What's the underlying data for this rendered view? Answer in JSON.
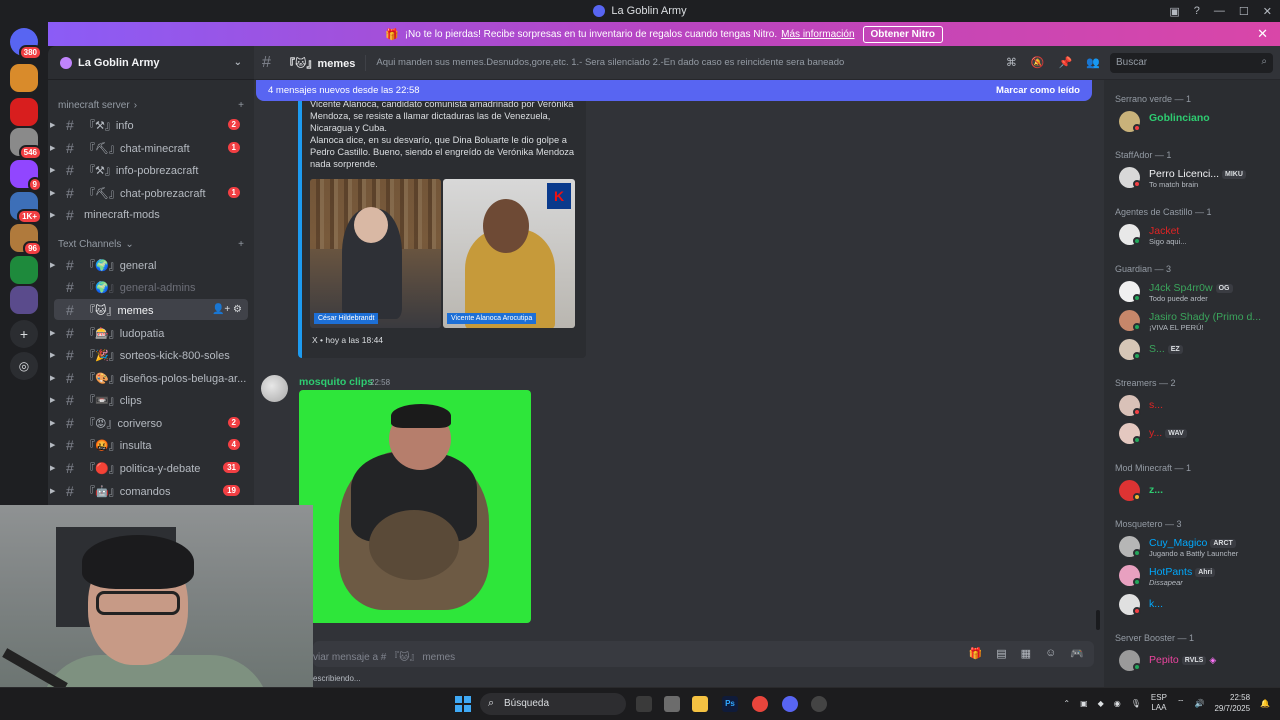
{
  "window": {
    "title": "La Goblin Army"
  },
  "rail": {
    "badges": [
      "380",
      "546",
      "9",
      "1K+",
      "96"
    ]
  },
  "nitro": {
    "text": "¡No te lo pierdas! Recibe sorpresas en tu inventario de regalos cuando tengas Nitro.",
    "link": "Más información",
    "button": "Obtener Nitro"
  },
  "guild": {
    "name": "La Goblin Army"
  },
  "sidebar": {
    "cat_minecraft": "minecraft server",
    "cat_text": "Text Channels",
    "channels": [
      {
        "name": "『⚒』info",
        "count": "2"
      },
      {
        "name": "『⛏』chat-minecraft",
        "count": "1"
      },
      {
        "name": "『⚒』info-pobrezacraft",
        "count": ""
      },
      {
        "name": "『⛏』chat-pobrezacraft",
        "count": "1"
      },
      {
        "name": "minecraft-mods",
        "count": ""
      },
      {
        "name": "『🌍』general",
        "count": ""
      },
      {
        "name": "『🌍』general-admins",
        "count": ""
      },
      {
        "name": "『🐱』memes",
        "count": ""
      },
      {
        "name": "『🎰』ludopatia",
        "count": ""
      },
      {
        "name": "『🎉』sorteos-kick-800-soles",
        "count": ""
      },
      {
        "name": "『🎨』diseños-polos-beluga-ar...",
        "count": ""
      },
      {
        "name": "『📼』clips",
        "count": ""
      },
      {
        "name": "『😡』coriverso",
        "count": "2"
      },
      {
        "name": "『🤬』insulta",
        "count": "4"
      },
      {
        "name": "『🔴』politica-y-debate",
        "count": "31"
      },
      {
        "name": "『🤖』comandos",
        "count": "19"
      }
    ]
  },
  "header": {
    "channel": "『🐱』memes",
    "topic": "Aqui manden sus memes.Desnudos,gore,etc. 1.- Sera silenciado 2.-En dado caso es reincidente sera baneado",
    "search_placeholder": "Buscar"
  },
  "newbar": {
    "text": "4 mensajes nuevos desde las 22:58",
    "action": "Marcar como leído"
  },
  "embed": {
    "text1": "Vicente Alanoca, candidato comunista amadrinado por Verónika Mendoza, se resiste a llamar dictaduras las de Venezuela, Nicaragua y Cuba.",
    "text2": "Alanoca dice, en su desvarío, que Dina Boluarte le dio golpe a Pedro Castillo. Bueno, siendo el engreído de Verónika Mendoza nada sorprende.",
    "caption1": "César Hildebrandt",
    "caption2": "Vicente Alanoca Arocutipa",
    "footer": "X • hoy a las 18:44"
  },
  "message2": {
    "author": "mosquito clips",
    "time": "22:58"
  },
  "composer": {
    "placeholder": "viar mensaje a # 『🐱』 memes",
    "typing": "escribiendo..."
  },
  "members": {
    "groups": [
      {
        "header": "Serrano verde — 1"
      },
      {
        "header": "StaffAdor — 1"
      },
      {
        "header": "Agentes de Castillo — 1"
      },
      {
        "header": "Guardian — 3"
      },
      {
        "header": "Streamers — 2"
      },
      {
        "header": "Mod Minecraft — 1"
      },
      {
        "header": "Mosquetero — 3"
      },
      {
        "header": "Server Booster — 1"
      }
    ],
    "list": [
      {
        "name": "Goblinciano",
        "sub": "",
        "tag": ""
      },
      {
        "name": "Perro Licenci...",
        "sub": "To match brain",
        "tag": "MIKU"
      },
      {
        "name": "Jacket",
        "sub": "Sigo aqui...",
        "tag": ""
      },
      {
        "name": "J4ck Sp4rr0w",
        "sub": "Todo puede arder",
        "tag": "OG"
      },
      {
        "name": "Jasiro Shady (Primo d...",
        "sub": "¡VIVA EL PERÚ!",
        "tag": ""
      },
      {
        "name": "S...",
        "sub": "",
        "tag": "EZ"
      },
      {
        "name": "s...",
        "sub": "",
        "tag": ""
      },
      {
        "name": "y...",
        "sub": "",
        "tag": "WAV"
      },
      {
        "name": "z...",
        "sub": "",
        "tag": ""
      },
      {
        "name": "Cuy_Magico",
        "sub": "Jugando a Battly Launcher",
        "tag": "ARCT"
      },
      {
        "name": "HotPants",
        "sub": "Dissapear",
        "tag": "Ahri"
      },
      {
        "name": "k...",
        "sub": "",
        "tag": ""
      },
      {
        "name": "Pepito",
        "sub": "",
        "tag": "RVLS"
      }
    ]
  },
  "taskbar": {
    "search": "Búsqueda",
    "lang1": "ESP",
    "lang2": "LAA",
    "time": "22:58",
    "date": "29/7/2025"
  }
}
